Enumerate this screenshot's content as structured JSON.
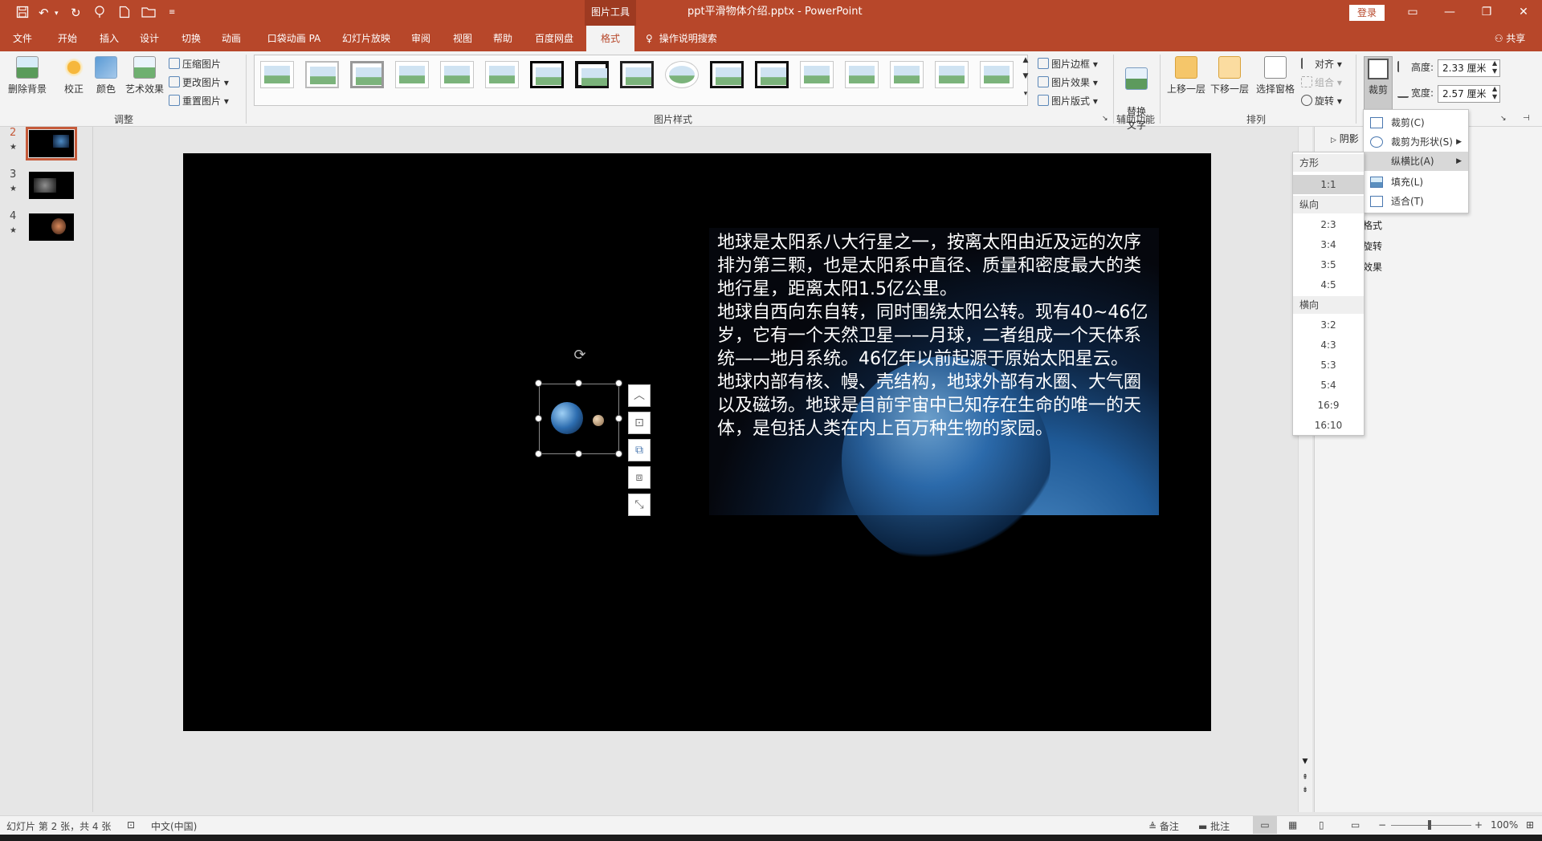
{
  "title_bar": {
    "quick_access_icons": [
      "save-icon",
      "undo-icon",
      "redo-icon",
      "format-painter-icon",
      "new-file-icon",
      "open-folder-icon",
      "customize-icon"
    ],
    "context_tab": "图片工具",
    "document_title": "ppt平滑物体介绍.pptx  -  PowerPoint",
    "login_label": "登录",
    "window_controls": [
      "ribbon-display-icon",
      "minimize-icon",
      "restore-icon",
      "close-icon"
    ],
    "colors": {
      "brand": "#b7472a",
      "context_tab_bg": "#9e3a21"
    }
  },
  "tabs": [
    {
      "label": "文件"
    },
    {
      "label": "开始"
    },
    {
      "label": "插入"
    },
    {
      "label": "设计"
    },
    {
      "label": "切换"
    },
    {
      "label": "动画"
    },
    {
      "label": "口袋动画 PA"
    },
    {
      "label": "幻灯片放映"
    },
    {
      "label": "审阅"
    },
    {
      "label": "视图"
    },
    {
      "label": "帮助"
    },
    {
      "label": "百度网盘"
    },
    {
      "label": "格式",
      "active": true
    }
  ],
  "tell_me": "操作说明搜索",
  "share_label": "共享",
  "ribbon": {
    "adjust": {
      "remove_bg": "删除背景",
      "corrections": "校正",
      "color": "颜色",
      "artistic": "艺术效果",
      "compress": "压缩图片",
      "change": "更改图片",
      "reset": "重置图片",
      "group_label": "调整"
    },
    "styles": {
      "group_label": "图片样式",
      "border": "图片边框",
      "effects": "图片效果",
      "layout": "图片版式"
    },
    "accessibility": {
      "alt_text": "替换\n文字",
      "group_label": "辅助功能"
    },
    "arrange": {
      "bring_forward": "上移一层",
      "send_backward": "下移一层",
      "selection_pane": "选择窗格",
      "align": "对齐",
      "group": "组合",
      "rotate": "旋转",
      "group_label": "排列"
    },
    "size": {
      "crop": "裁剪",
      "height_label": "高度:",
      "height_value": "2.33 厘米",
      "width_label": "宽度:",
      "width_value": "2.57 厘米"
    }
  },
  "slides": [
    {
      "number": "2",
      "star": "★",
      "selected": true
    },
    {
      "number": "3",
      "star": "★"
    },
    {
      "number": "4",
      "star": "★"
    }
  ],
  "slide_text": [
    "地球是太阳系八大行星之一，按离太阳由近及远的次序排为第三颗，也是太阳系中直径、质量和密度最大的类地行星，距离太阳1.5亿公里。",
    "地球自西向东自转，同时围绕太阳公转。现有40~46亿岁，它有一个天然卫星——月球，二者组成一个天体系统——地月系统。46亿年以前起源于原始太阳星云。",
    "地球内部有核、幔、壳结构，地球外部有水圈、大气圈以及磁场。地球是目前宇宙中已知存在生命的唯一的天体，是包括人类在内上百万种生物的家园。"
  ],
  "right_pane": {
    "section_shadow": "阴影",
    "items": [
      "格式",
      "旋转",
      "效果"
    ]
  },
  "crop_menu": {
    "items": [
      {
        "label": "裁剪(C)",
        "icon": "crop-icon"
      },
      {
        "label": "裁剪为形状(S)",
        "icon": "shape-crop-icon",
        "submenu": true
      },
      {
        "label": "纵横比(A)",
        "submenu": true,
        "highlighted": true
      },
      {
        "label": "填充(L)",
        "icon": "fill-icon"
      },
      {
        "label": "适合(T)",
        "icon": "fit-icon"
      }
    ]
  },
  "ratio_menu": {
    "square_header": "方形",
    "square": [
      "1:1"
    ],
    "portrait_header": "纵向",
    "portrait": [
      "2:3",
      "3:4",
      "3:5",
      "4:5"
    ],
    "landscape_header": "横向",
    "landscape": [
      "3:2",
      "4:3",
      "5:3",
      "5:4",
      "16:9",
      "16:10"
    ]
  },
  "status_bar": {
    "slide_info": "幻灯片 第 2 张，共 4 张",
    "language": "中文(中国)",
    "notes": "备注",
    "comments": "批注",
    "zoom_minus": "−",
    "zoom_plus": "+",
    "zoom_level": "100%"
  }
}
